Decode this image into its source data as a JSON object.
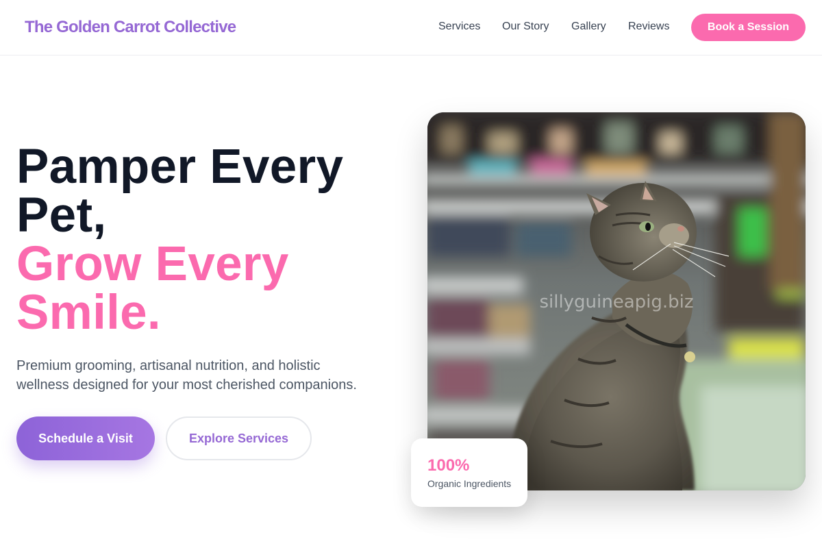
{
  "header": {
    "logo": "The Golden Carrot Collective",
    "nav": [
      "Services",
      "Our Story",
      "Gallery",
      "Reviews"
    ],
    "cta": "Book a Session"
  },
  "hero": {
    "title_line1": "Pamper Every",
    "title_line2": "Pet,",
    "title_line3": "Grow Every",
    "title_line4": "Smile.",
    "subtitle": "Premium grooming, artisanal nutrition, and holistic wellness designed for your most cherished companions.",
    "primary_button": "Schedule a Visit",
    "secondary_button": "Explore Services"
  },
  "image": {
    "subject": "tabby cat in pet store",
    "watermark": "sillyguineapig.biz"
  },
  "stat": {
    "value": "100%",
    "label": "Organic Ingredients"
  },
  "colors": {
    "brand_purple": "#9568d4",
    "accent_pink": "#fb6aae",
    "heading": "#111827",
    "body_text": "#4b5563"
  }
}
